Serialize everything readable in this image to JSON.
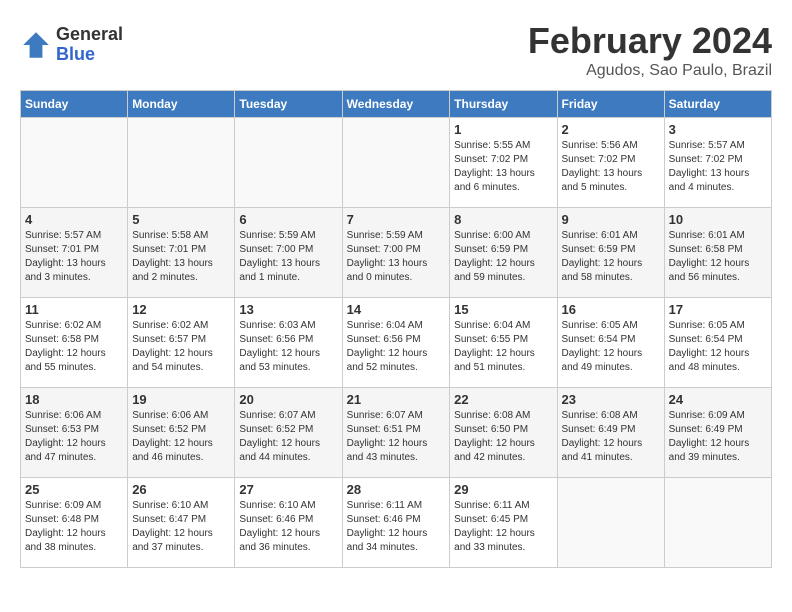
{
  "header": {
    "logo_general": "General",
    "logo_blue": "Blue",
    "month_title": "February 2024",
    "location": "Agudos, Sao Paulo, Brazil"
  },
  "weekdays": [
    "Sunday",
    "Monday",
    "Tuesday",
    "Wednesday",
    "Thursday",
    "Friday",
    "Saturday"
  ],
  "weeks": [
    [
      {
        "day": "",
        "info": ""
      },
      {
        "day": "",
        "info": ""
      },
      {
        "day": "",
        "info": ""
      },
      {
        "day": "",
        "info": ""
      },
      {
        "day": "1",
        "info": "Sunrise: 5:55 AM\nSunset: 7:02 PM\nDaylight: 13 hours\nand 6 minutes."
      },
      {
        "day": "2",
        "info": "Sunrise: 5:56 AM\nSunset: 7:02 PM\nDaylight: 13 hours\nand 5 minutes."
      },
      {
        "day": "3",
        "info": "Sunrise: 5:57 AM\nSunset: 7:02 PM\nDaylight: 13 hours\nand 4 minutes."
      }
    ],
    [
      {
        "day": "4",
        "info": "Sunrise: 5:57 AM\nSunset: 7:01 PM\nDaylight: 13 hours\nand 3 minutes."
      },
      {
        "day": "5",
        "info": "Sunrise: 5:58 AM\nSunset: 7:01 PM\nDaylight: 13 hours\nand 2 minutes."
      },
      {
        "day": "6",
        "info": "Sunrise: 5:59 AM\nSunset: 7:00 PM\nDaylight: 13 hours\nand 1 minute."
      },
      {
        "day": "7",
        "info": "Sunrise: 5:59 AM\nSunset: 7:00 PM\nDaylight: 13 hours\nand 0 minutes."
      },
      {
        "day": "8",
        "info": "Sunrise: 6:00 AM\nSunset: 6:59 PM\nDaylight: 12 hours\nand 59 minutes."
      },
      {
        "day": "9",
        "info": "Sunrise: 6:01 AM\nSunset: 6:59 PM\nDaylight: 12 hours\nand 58 minutes."
      },
      {
        "day": "10",
        "info": "Sunrise: 6:01 AM\nSunset: 6:58 PM\nDaylight: 12 hours\nand 56 minutes."
      }
    ],
    [
      {
        "day": "11",
        "info": "Sunrise: 6:02 AM\nSunset: 6:58 PM\nDaylight: 12 hours\nand 55 minutes."
      },
      {
        "day": "12",
        "info": "Sunrise: 6:02 AM\nSunset: 6:57 PM\nDaylight: 12 hours\nand 54 minutes."
      },
      {
        "day": "13",
        "info": "Sunrise: 6:03 AM\nSunset: 6:56 PM\nDaylight: 12 hours\nand 53 minutes."
      },
      {
        "day": "14",
        "info": "Sunrise: 6:04 AM\nSunset: 6:56 PM\nDaylight: 12 hours\nand 52 minutes."
      },
      {
        "day": "15",
        "info": "Sunrise: 6:04 AM\nSunset: 6:55 PM\nDaylight: 12 hours\nand 51 minutes."
      },
      {
        "day": "16",
        "info": "Sunrise: 6:05 AM\nSunset: 6:54 PM\nDaylight: 12 hours\nand 49 minutes."
      },
      {
        "day": "17",
        "info": "Sunrise: 6:05 AM\nSunset: 6:54 PM\nDaylight: 12 hours\nand 48 minutes."
      }
    ],
    [
      {
        "day": "18",
        "info": "Sunrise: 6:06 AM\nSunset: 6:53 PM\nDaylight: 12 hours\nand 47 minutes."
      },
      {
        "day": "19",
        "info": "Sunrise: 6:06 AM\nSunset: 6:52 PM\nDaylight: 12 hours\nand 46 minutes."
      },
      {
        "day": "20",
        "info": "Sunrise: 6:07 AM\nSunset: 6:52 PM\nDaylight: 12 hours\nand 44 minutes."
      },
      {
        "day": "21",
        "info": "Sunrise: 6:07 AM\nSunset: 6:51 PM\nDaylight: 12 hours\nand 43 minutes."
      },
      {
        "day": "22",
        "info": "Sunrise: 6:08 AM\nSunset: 6:50 PM\nDaylight: 12 hours\nand 42 minutes."
      },
      {
        "day": "23",
        "info": "Sunrise: 6:08 AM\nSunset: 6:49 PM\nDaylight: 12 hours\nand 41 minutes."
      },
      {
        "day": "24",
        "info": "Sunrise: 6:09 AM\nSunset: 6:49 PM\nDaylight: 12 hours\nand 39 minutes."
      }
    ],
    [
      {
        "day": "25",
        "info": "Sunrise: 6:09 AM\nSunset: 6:48 PM\nDaylight: 12 hours\nand 38 minutes."
      },
      {
        "day": "26",
        "info": "Sunrise: 6:10 AM\nSunset: 6:47 PM\nDaylight: 12 hours\nand 37 minutes."
      },
      {
        "day": "27",
        "info": "Sunrise: 6:10 AM\nSunset: 6:46 PM\nDaylight: 12 hours\nand 36 minutes."
      },
      {
        "day": "28",
        "info": "Sunrise: 6:11 AM\nSunset: 6:46 PM\nDaylight: 12 hours\nand 34 minutes."
      },
      {
        "day": "29",
        "info": "Sunrise: 6:11 AM\nSunset: 6:45 PM\nDaylight: 12 hours\nand 33 minutes."
      },
      {
        "day": "",
        "info": ""
      },
      {
        "day": "",
        "info": ""
      }
    ]
  ]
}
